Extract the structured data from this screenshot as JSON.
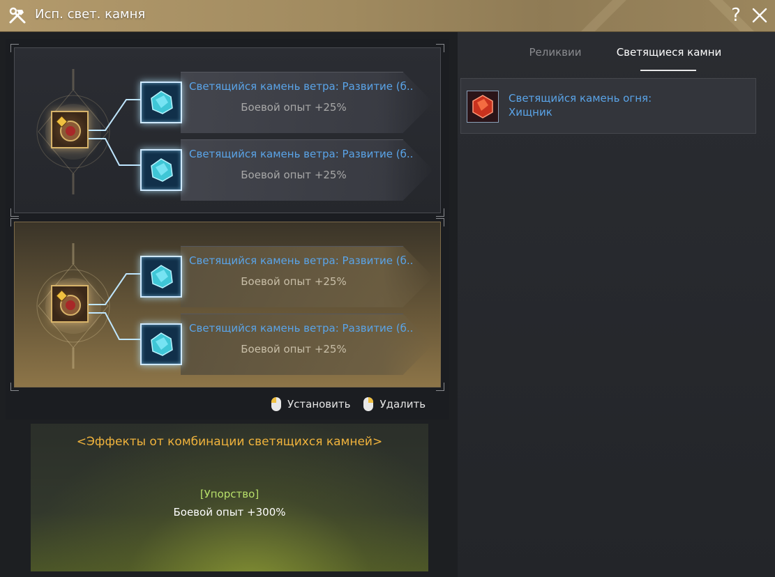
{
  "window": {
    "title": "Исп. свет. камня",
    "help_label": "?"
  },
  "slot_groups": [
    {
      "stones": [
        {
          "name": "Светящийся камень ветра: Развитие (б...",
          "effect": "Боевой опыт +25%"
        },
        {
          "name": "Светящийся камень ветра: Развитие (б...",
          "effect": "Боевой опыт +25%"
        }
      ]
    },
    {
      "stones": [
        {
          "name": "Светящийся камень ветра: Развитие (б...",
          "effect": "Боевой опыт +25%"
        },
        {
          "name": "Светящийся камень ветра: Развитие (б...",
          "effect": "Боевой опыт +25%"
        }
      ]
    }
  ],
  "hints": {
    "install": "Установить",
    "remove": "Удалить"
  },
  "combination": {
    "title": "<Эффекты от комбинации светящихся камней>",
    "set_name": "[Упорство]",
    "effect": "Боевой опыт +300%"
  },
  "tabs": {
    "relics": "Реликвии",
    "glowing_stones": "Светящиеся камни",
    "active": "glowing_stones"
  },
  "inventory": [
    {
      "name": "Светящийся камень огня:\nХищник",
      "icon": "fire-stone-icon"
    }
  ],
  "colors": {
    "stone_name": "#5aa4e8",
    "combo_title": "#f0b33c",
    "combo_set": "#b8e06a",
    "title_bar": "#a08a5f"
  }
}
